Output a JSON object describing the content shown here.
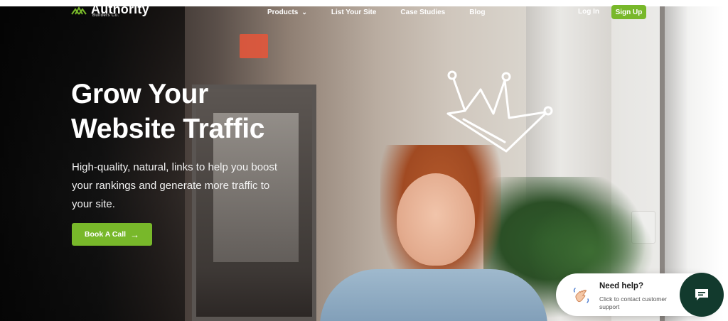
{
  "header": {
    "logo_name": "Authority",
    "logo_sub": "Builders Co.",
    "nav": [
      {
        "label": "Products",
        "has_dropdown": true
      },
      {
        "label": "List Your Site"
      },
      {
        "label": "Case Studies"
      },
      {
        "label": "Blog"
      }
    ],
    "login_label": "Log In",
    "signup_label": "Sign Up"
  },
  "hero": {
    "headline_line1": "Grow Your",
    "headline_line2": "Website Traffic",
    "subtext": "High-quality, natural, links to help you boost your rankings and generate more traffic to your site.",
    "cta_label": "Book A Call",
    "cta_icon": "arrow-right-icon"
  },
  "help_widget": {
    "title": "Need help?",
    "subtitle": "Click to contact customer support",
    "icon": "waving-hand-icon",
    "chat_icon": "chat-bubble-icon"
  },
  "colors": {
    "accent_green": "#78b82a",
    "chat_button": "#123a2d",
    "text_light": "#ffffff"
  }
}
